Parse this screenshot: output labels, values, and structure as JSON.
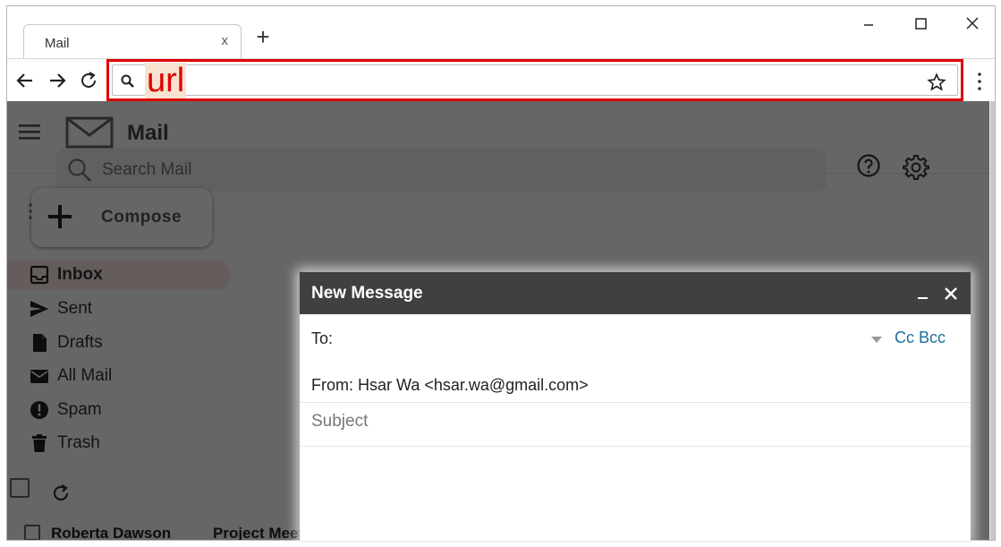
{
  "browser": {
    "tab_title": "Mail",
    "tab_close": "x",
    "new_tab": "+",
    "url_label": "url",
    "url_value": ""
  },
  "mail": {
    "app_name": "Mail",
    "search_placeholder": "Search Mail",
    "compose_label": "Compose",
    "nav": [
      {
        "label": "Inbox",
        "icon": "inbox-icon",
        "active": true
      },
      {
        "label": "Sent",
        "icon": "send-icon"
      },
      {
        "label": "Drafts",
        "icon": "draft-icon"
      },
      {
        "label": "All Mail",
        "icon": "mail-icon"
      },
      {
        "label": "Spam",
        "icon": "spam-icon"
      },
      {
        "label": "Trash",
        "icon": "trash-icon"
      }
    ],
    "rows": [
      {
        "sender": "Roberta Dawson",
        "subject": "Project Meeting"
      }
    ]
  },
  "dialog": {
    "title": "New Message",
    "to_label": "To:",
    "cc_bcc": "Cc Bcc",
    "from": "From: Hsar Wa <hsar.wa@gmail.com>",
    "subject_placeholder": "Subject"
  },
  "colors": {
    "accent_red": "#e00000",
    "dialog_header": "#404040",
    "link_blue": "#1a6f9a"
  }
}
